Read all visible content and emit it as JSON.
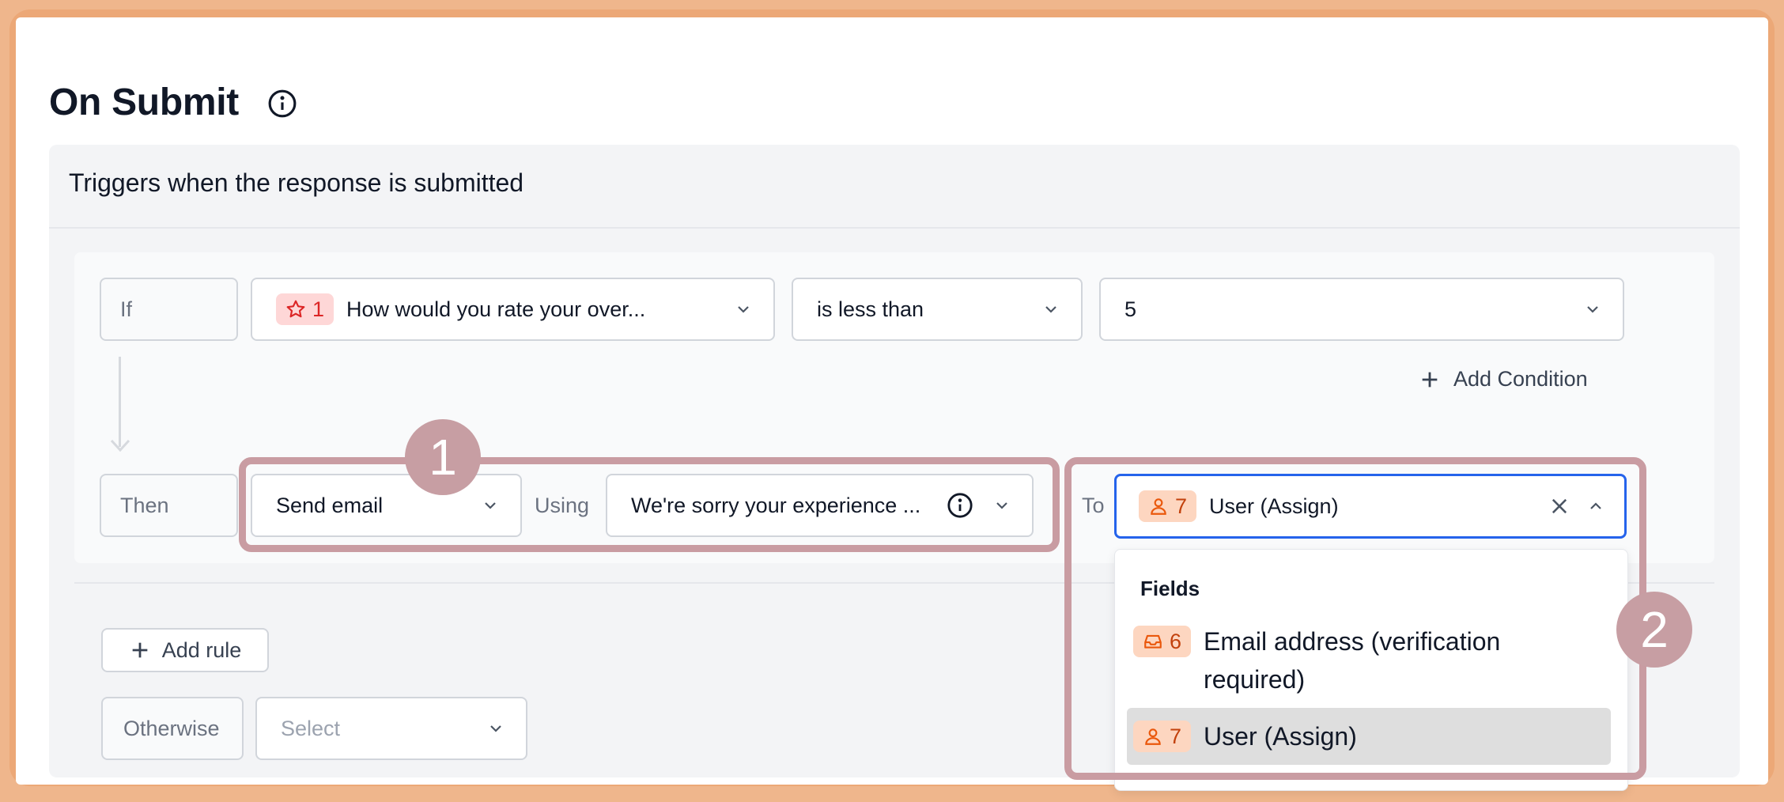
{
  "page": {
    "title": "On Submit",
    "trigger_description": "Triggers when the response is submitted"
  },
  "rule": {
    "if_label": "If",
    "condition": {
      "field_badge_num": "1",
      "field_badge_icon": "star-icon",
      "field_label": "How would you rate your over...",
      "operator": "is less than",
      "value": "5"
    },
    "add_condition_label": "Add Condition",
    "then_label": "Then",
    "action": "Send email",
    "using_label": "Using",
    "template": "We're sorry your experience ...",
    "to_label": "To",
    "to_value": {
      "badge_num": "7",
      "badge_icon": "user-icon",
      "label": "User (Assign)"
    }
  },
  "dropdown": {
    "header": "Fields",
    "options": [
      {
        "badge_num": "6",
        "badge_icon": "inbox-icon",
        "label_line1": "Email address (verification",
        "label_line2": "required)",
        "selected": false
      },
      {
        "badge_num": "7",
        "badge_icon": "user-icon",
        "label_line1": "User (Assign)",
        "selected": true
      }
    ]
  },
  "add_rule_label": "Add rule",
  "otherwise": {
    "label": "Otherwise",
    "placeholder": "Select"
  },
  "annotations": {
    "step1": "1",
    "step2": "2"
  },
  "colors": {
    "frame": "#eca877",
    "highlight": "#c99ca2",
    "focus_border": "#2563eb",
    "badge_red_bg": "#fed7d7",
    "badge_orange_bg": "#fdd6c0"
  }
}
